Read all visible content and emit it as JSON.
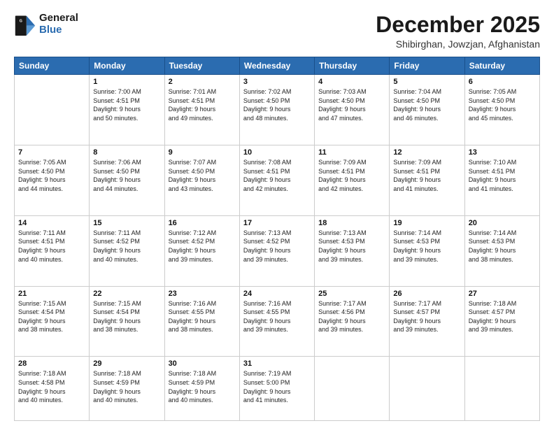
{
  "header": {
    "logo": {
      "general": "General",
      "blue": "Blue"
    },
    "title": "December 2025",
    "subtitle": "Shibirghan, Jowzjan, Afghanistan"
  },
  "days_of_week": [
    "Sunday",
    "Monday",
    "Tuesday",
    "Wednesday",
    "Thursday",
    "Friday",
    "Saturday"
  ],
  "weeks": [
    [
      {
        "day": "",
        "content": ""
      },
      {
        "day": "1",
        "content": "Sunrise: 7:00 AM\nSunset: 4:51 PM\nDaylight: 9 hours\nand 50 minutes."
      },
      {
        "day": "2",
        "content": "Sunrise: 7:01 AM\nSunset: 4:51 PM\nDaylight: 9 hours\nand 49 minutes."
      },
      {
        "day": "3",
        "content": "Sunrise: 7:02 AM\nSunset: 4:50 PM\nDaylight: 9 hours\nand 48 minutes."
      },
      {
        "day": "4",
        "content": "Sunrise: 7:03 AM\nSunset: 4:50 PM\nDaylight: 9 hours\nand 47 minutes."
      },
      {
        "day": "5",
        "content": "Sunrise: 7:04 AM\nSunset: 4:50 PM\nDaylight: 9 hours\nand 46 minutes."
      },
      {
        "day": "6",
        "content": "Sunrise: 7:05 AM\nSunset: 4:50 PM\nDaylight: 9 hours\nand 45 minutes."
      }
    ],
    [
      {
        "day": "7",
        "content": "Sunrise: 7:05 AM\nSunset: 4:50 PM\nDaylight: 9 hours\nand 44 minutes."
      },
      {
        "day": "8",
        "content": "Sunrise: 7:06 AM\nSunset: 4:50 PM\nDaylight: 9 hours\nand 44 minutes."
      },
      {
        "day": "9",
        "content": "Sunrise: 7:07 AM\nSunset: 4:50 PM\nDaylight: 9 hours\nand 43 minutes."
      },
      {
        "day": "10",
        "content": "Sunrise: 7:08 AM\nSunset: 4:51 PM\nDaylight: 9 hours\nand 42 minutes."
      },
      {
        "day": "11",
        "content": "Sunrise: 7:09 AM\nSunset: 4:51 PM\nDaylight: 9 hours\nand 42 minutes."
      },
      {
        "day": "12",
        "content": "Sunrise: 7:09 AM\nSunset: 4:51 PM\nDaylight: 9 hours\nand 41 minutes."
      },
      {
        "day": "13",
        "content": "Sunrise: 7:10 AM\nSunset: 4:51 PM\nDaylight: 9 hours\nand 41 minutes."
      }
    ],
    [
      {
        "day": "14",
        "content": "Sunrise: 7:11 AM\nSunset: 4:51 PM\nDaylight: 9 hours\nand 40 minutes."
      },
      {
        "day": "15",
        "content": "Sunrise: 7:11 AM\nSunset: 4:52 PM\nDaylight: 9 hours\nand 40 minutes."
      },
      {
        "day": "16",
        "content": "Sunrise: 7:12 AM\nSunset: 4:52 PM\nDaylight: 9 hours\nand 39 minutes."
      },
      {
        "day": "17",
        "content": "Sunrise: 7:13 AM\nSunset: 4:52 PM\nDaylight: 9 hours\nand 39 minutes."
      },
      {
        "day": "18",
        "content": "Sunrise: 7:13 AM\nSunset: 4:53 PM\nDaylight: 9 hours\nand 39 minutes."
      },
      {
        "day": "19",
        "content": "Sunrise: 7:14 AM\nSunset: 4:53 PM\nDaylight: 9 hours\nand 39 minutes."
      },
      {
        "day": "20",
        "content": "Sunrise: 7:14 AM\nSunset: 4:53 PM\nDaylight: 9 hours\nand 38 minutes."
      }
    ],
    [
      {
        "day": "21",
        "content": "Sunrise: 7:15 AM\nSunset: 4:54 PM\nDaylight: 9 hours\nand 38 minutes."
      },
      {
        "day": "22",
        "content": "Sunrise: 7:15 AM\nSunset: 4:54 PM\nDaylight: 9 hours\nand 38 minutes."
      },
      {
        "day": "23",
        "content": "Sunrise: 7:16 AM\nSunset: 4:55 PM\nDaylight: 9 hours\nand 38 minutes."
      },
      {
        "day": "24",
        "content": "Sunrise: 7:16 AM\nSunset: 4:55 PM\nDaylight: 9 hours\nand 39 minutes."
      },
      {
        "day": "25",
        "content": "Sunrise: 7:17 AM\nSunset: 4:56 PM\nDaylight: 9 hours\nand 39 minutes."
      },
      {
        "day": "26",
        "content": "Sunrise: 7:17 AM\nSunset: 4:57 PM\nDaylight: 9 hours\nand 39 minutes."
      },
      {
        "day": "27",
        "content": "Sunrise: 7:18 AM\nSunset: 4:57 PM\nDaylight: 9 hours\nand 39 minutes."
      }
    ],
    [
      {
        "day": "28",
        "content": "Sunrise: 7:18 AM\nSunset: 4:58 PM\nDaylight: 9 hours\nand 40 minutes."
      },
      {
        "day": "29",
        "content": "Sunrise: 7:18 AM\nSunset: 4:59 PM\nDaylight: 9 hours\nand 40 minutes."
      },
      {
        "day": "30",
        "content": "Sunrise: 7:18 AM\nSunset: 4:59 PM\nDaylight: 9 hours\nand 40 minutes."
      },
      {
        "day": "31",
        "content": "Sunrise: 7:19 AM\nSunset: 5:00 PM\nDaylight: 9 hours\nand 41 minutes."
      },
      {
        "day": "",
        "content": ""
      },
      {
        "day": "",
        "content": ""
      },
      {
        "day": "",
        "content": ""
      }
    ]
  ]
}
